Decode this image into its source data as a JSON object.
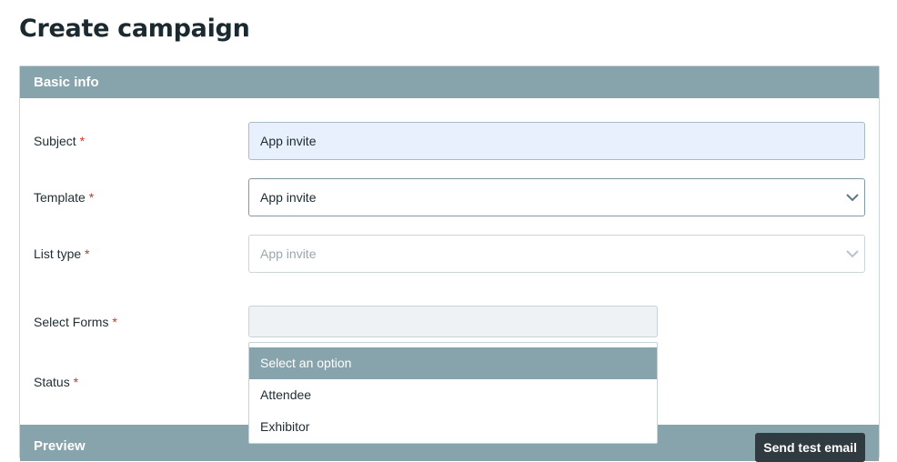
{
  "page": {
    "title": "Create campaign"
  },
  "basic_info": {
    "header": "Basic info",
    "subject": {
      "label": "Subject",
      "required_mark": "*",
      "value": "App invite"
    },
    "template": {
      "label": "Template",
      "required_mark": "*",
      "value": "App invite"
    },
    "list_type": {
      "label": "List type",
      "required_mark": "*",
      "value": "App invite"
    },
    "select_forms": {
      "label": "Select Forms",
      "required_mark": "*",
      "value": ""
    },
    "status": {
      "label": "Status",
      "required_mark": "*"
    }
  },
  "forms_dropdown": {
    "options": [
      "Select an option",
      "Attendee",
      "Exhibitor"
    ],
    "highlighted": "Select an option"
  },
  "preview": {
    "header": "Preview",
    "send_test_label": "Send test email"
  },
  "colors": {
    "header_bg": "#87a3ab",
    "required": "#d2302c",
    "autofill_bg": "#e8f0fe",
    "button_bg": "#2f3b40"
  }
}
